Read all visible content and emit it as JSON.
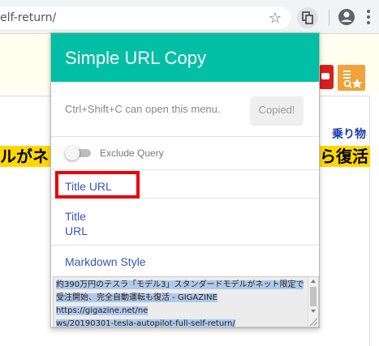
{
  "browser": {
    "url": "elf-return/",
    "icons": [
      "star-icon",
      "copy-extension-icon",
      "account-icon",
      "more-menu-icon"
    ]
  },
  "page": {
    "link_text": "乗り物",
    "headline_left": "ルがネッ",
    "headline_right": "ら復活"
  },
  "popup": {
    "title": "Simple URL Copy",
    "hint": "Ctrl+Shift+C can open this menu.",
    "copied_button": "Copied!",
    "toggle_label": "Exclude Query",
    "toggle_on": false,
    "items": [
      {
        "label": "Title URL"
      },
      {
        "line1": "Title",
        "line2": "URL"
      },
      {
        "label": "Markdown Style"
      }
    ],
    "output_lines": [
      "約390万円のテスラ「モデル3」スタンダードモデルがネット限定で",
      "受注開始、完全自動運転も復活 - GIGAZINE https://gigazine.net/ne",
      "ws/20190301-tesla-autopilot-full-self-return/"
    ]
  },
  "colors": {
    "header": "#00bfa5",
    "highlight_box": "#e8000c",
    "link": "#3b54b8",
    "page_highlight": "#ffd800"
  }
}
